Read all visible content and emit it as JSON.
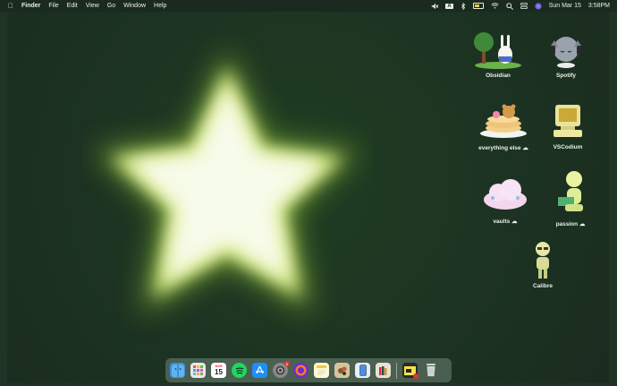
{
  "menubar": {
    "app_name": "Finder",
    "menus": [
      "File",
      "Edit",
      "View",
      "Go",
      "Window",
      "Help"
    ],
    "input_source": "A",
    "date": "Sun Mar 15",
    "time": "3:58PM"
  },
  "desktop_icons": [
    {
      "label": "Obsidian",
      "icon": "bunny-tree-icon"
    },
    {
      "label": "Spotify",
      "icon": "cat-headphones-icon"
    },
    {
      "label": "everything else",
      "icon": "pancake-bear-icon"
    },
    {
      "label": "VSCodium",
      "icon": "retro-computer-icon"
    },
    {
      "label": "vaults",
      "icon": "cloud-icon"
    },
    {
      "label": "passion",
      "icon": "figure-laptop-icon"
    },
    {
      "label": "Calibre",
      "icon": "figure-books-icon"
    }
  ],
  "dock": {
    "calendar_day": "15",
    "calendar_month": "MAR",
    "system_settings_badge": "1"
  },
  "colors": {
    "background": "#1d3322",
    "star_core": "#f7fbe9",
    "star_glow": "#d9ea8a"
  }
}
